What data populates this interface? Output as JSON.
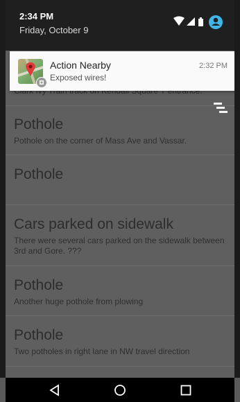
{
  "status_bar": {
    "time": "2:34 PM",
    "date": "Friday, October 9"
  },
  "notification": {
    "app_name": "Action Nearby",
    "text": "Exposed wires!",
    "time": "2:32 PM"
  },
  "list": {
    "partial_text": "Clark Ivy Train track on Kendall Square T entrance.",
    "items": [
      {
        "title": "Pothole",
        "description": "Pothole on the corner of Mass Ave and Vassar."
      },
      {
        "title": "Pothole",
        "description": ""
      },
      {
        "title": "Cars parked on sidewalk",
        "description": "There were several cars parked on the sidewalk between 3rd and Gore.  ???"
      },
      {
        "title": "Pothole",
        "description": "Another huge pothole from plowing"
      },
      {
        "title": "Pothole",
        "description": "Two potholes in right lane in NW travel direction"
      }
    ]
  },
  "icons": {
    "status": [
      "wifi-icon",
      "signal-icon",
      "battery-icon",
      "account-icon"
    ],
    "nav": [
      "back-icon",
      "home-icon",
      "recents-icon"
    ],
    "overflow": "overflow-menu-icon"
  }
}
